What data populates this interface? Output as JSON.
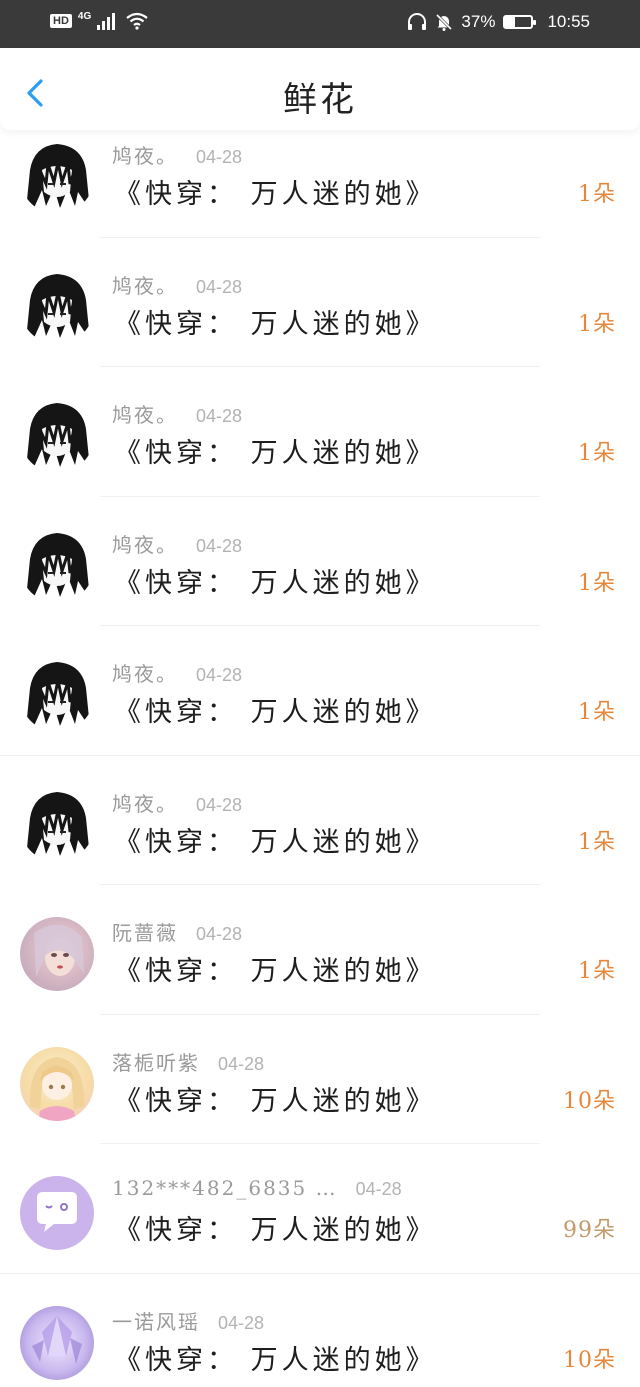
{
  "status_bar": {
    "hd": "HD",
    "network": "4G",
    "battery_percent": "37%",
    "battery_level": 0.37,
    "time": "10:55",
    "icons": [
      "signal-icon",
      "wifi-icon",
      "headphones-icon",
      "mute-icon",
      "battery-icon"
    ]
  },
  "header": {
    "title": "鲜花",
    "back_icon": "chevron-left-icon",
    "accent_color": "#2a9df4"
  },
  "colors": {
    "count_orange": "#e8873a",
    "count_gray": "#c39a6a"
  },
  "list": {
    "items": [
      {
        "username": "鸠夜。",
        "date": "04-28",
        "book": "《快穿： 万人迷的她》",
        "count": "1朵",
        "avatar": "dark-hair-avatar"
      },
      {
        "username": "鸠夜。",
        "date": "04-28",
        "book": "《快穿： 万人迷的她》",
        "count": "1朵",
        "avatar": "dark-hair-avatar"
      },
      {
        "username": "鸠夜。",
        "date": "04-28",
        "book": "《快穿： 万人迷的她》",
        "count": "1朵",
        "avatar": "dark-hair-avatar"
      },
      {
        "username": "鸠夜。",
        "date": "04-28",
        "book": "《快穿： 万人迷的她》",
        "count": "1朵",
        "avatar": "dark-hair-avatar"
      },
      {
        "username": "鸠夜。",
        "date": "04-28",
        "book": "《快穿： 万人迷的她》",
        "count": "1朵",
        "avatar": "dark-hair-avatar"
      },
      {
        "username": "鸠夜。",
        "date": "04-28",
        "book": "《快穿： 万人迷的她》",
        "count": "1朵",
        "avatar": "dark-hair-avatar"
      },
      {
        "username": "阮蔷薇",
        "date": "04-28",
        "book": "《快穿： 万人迷的她》",
        "count": "1朵",
        "avatar": "pink-girl-avatar"
      },
      {
        "username": "落栀听紫",
        "date": "04-28",
        "book": "《快穿： 万人迷的她》",
        "count": "10朵",
        "avatar": "blonde-girl-avatar"
      },
      {
        "username": "132***482_6835 …",
        "date": "04-28",
        "book": "《快穿： 万人迷的她》",
        "count": "99朵",
        "avatar": "chat-bubble-avatar"
      },
      {
        "username": "一诺风瑶",
        "date": "04-28",
        "book": "《快穿： 万人迷的她》",
        "count": "10朵",
        "avatar": "crystal-avatar"
      }
    ]
  }
}
